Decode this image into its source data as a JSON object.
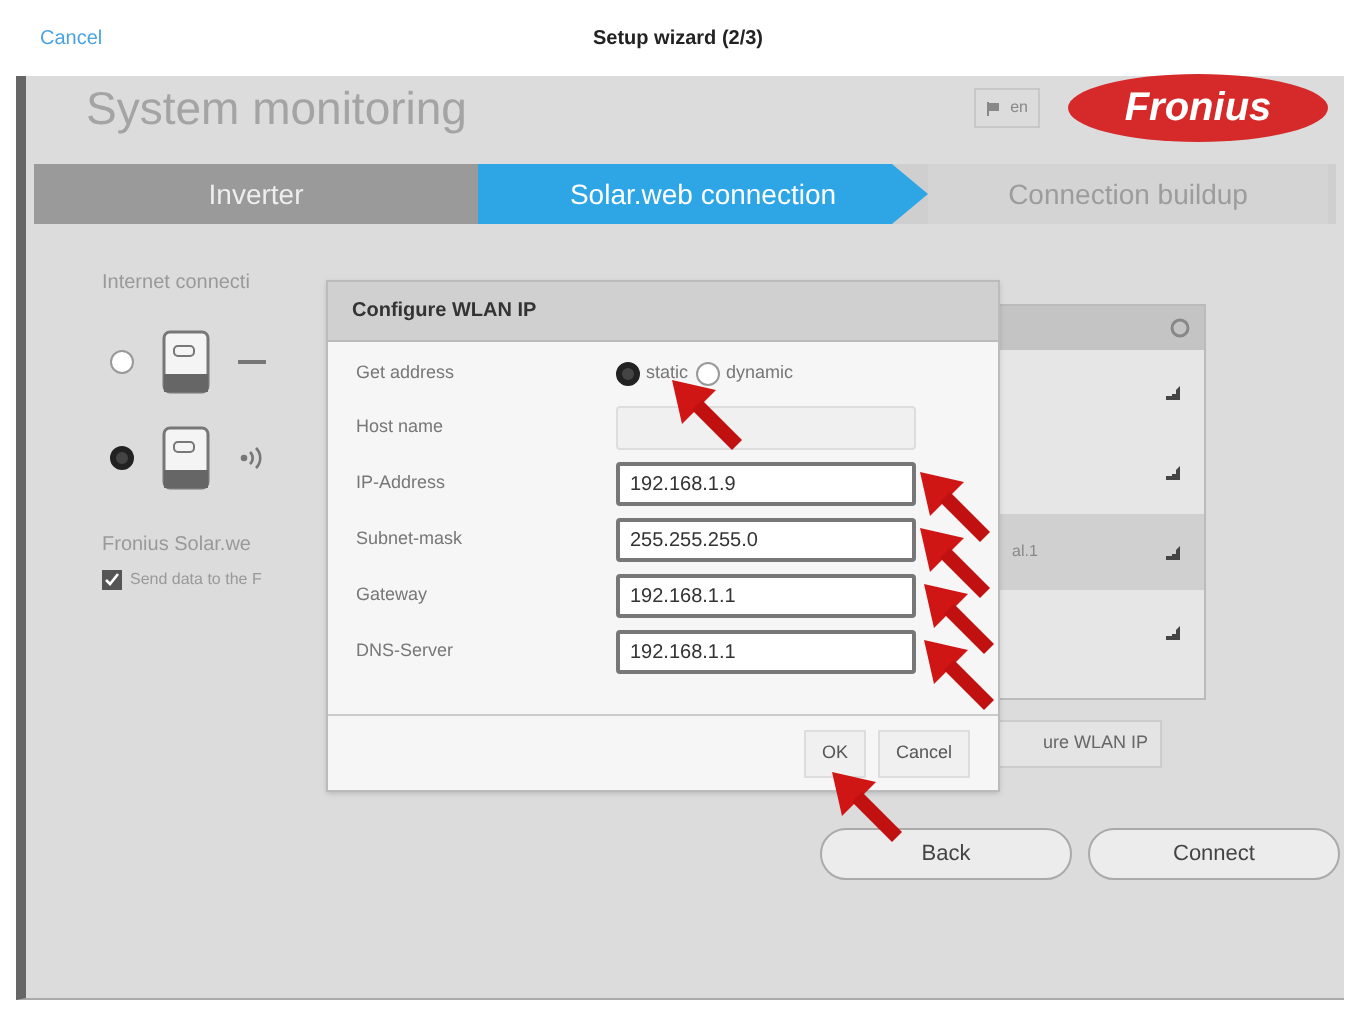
{
  "top_bar": {
    "cancel": "Cancel",
    "title": "Setup wizard (2/3)"
  },
  "header": {
    "title": "System monitoring",
    "language": "en",
    "logo": "Fronius"
  },
  "steps": [
    {
      "label": "Inverter",
      "selected": false,
      "completed": true
    },
    {
      "label": "Solar.web connection",
      "selected": true,
      "completed": false
    },
    {
      "label": "Connection buildup",
      "selected": false,
      "completed": false
    }
  ],
  "internet": {
    "label": "Internet connecti",
    "options": [
      {
        "kind": "cable",
        "selected": false
      },
      {
        "kind": "wifi",
        "selected": true
      }
    ]
  },
  "solarweb": {
    "label": "Fronius Solar.we",
    "checkbox": {
      "label": "Send data to the F",
      "checked": true
    }
  },
  "wlan_list": {
    "rows": [
      {
        "selected": false
      },
      {
        "selected": false
      },
      {
        "text": "al.1",
        "selected": true
      },
      {
        "selected": false
      }
    ],
    "configure_button": "ure WLAN IP"
  },
  "footer_buttons": [
    "Back",
    "Connect"
  ],
  "dialog": {
    "title": "Configure WLAN IP",
    "get_address": {
      "label": "Get address",
      "options": [
        {
          "label": "static",
          "selected": true
        },
        {
          "label": "dynamic",
          "selected": false
        }
      ]
    },
    "fields": [
      {
        "label": "Host name",
        "disabled": true
      },
      {
        "label": "IP-Address",
        "value": "192.168.1.9",
        "disabled": false
      },
      {
        "label": "Subnet-mask",
        "value": "255.255.255.0",
        "disabled": false
      },
      {
        "label": "Gateway",
        "value": "192.168.1.1",
        "disabled": false
      },
      {
        "label": "DNS-Server",
        "value": "192.168.1.1",
        "disabled": false
      }
    ],
    "buttons": [
      "OK",
      "Cancel"
    ]
  }
}
